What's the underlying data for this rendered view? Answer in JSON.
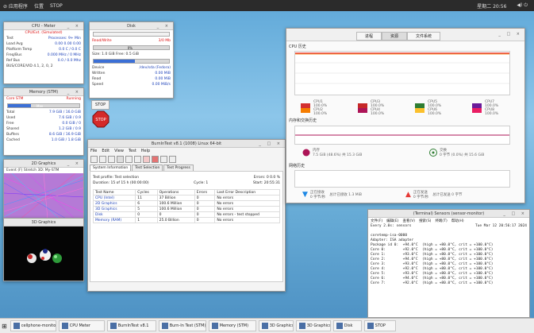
{
  "topbar": {
    "apps": "⊘ 应用程序",
    "places": "位置",
    "stop": "STOP",
    "clock": "星期二 20:56",
    "sys": "◀) ⏻"
  },
  "cpu_win": {
    "title": "CPU - Meter",
    "header": "CPU/Ext. (Simulated)",
    "rows": [
      {
        "k": "Test",
        "v": "Processes: 9+ Min"
      },
      {
        "k": "Load Avg",
        "v": "0.00 0.00 0.00"
      },
      {
        "k": "Platform Temp",
        "v": "0.0 C / 0.0 C"
      },
      {
        "k": "Freq/Bus",
        "v": "0.000 MHz / 0 MHz"
      },
      {
        "k": "Ref Bus",
        "v": "0.0 / 0.0 Mhz"
      }
    ],
    "footer": "BUS/CORE/VID 4.1, 2, 0, 2"
  },
  "mem_win": {
    "title": "Memory (STM)",
    "cpu_label": "Core STM",
    "cpu_value": "Running",
    "bar_label": "Max",
    "bar_pct": 0.32,
    "rows": [
      {
        "k": "Total",
        "v": "7.9 GiB / 16.0 GiB"
      },
      {
        "k": "Used",
        "v": "7.6 GiB / 0.9"
      },
      {
        "k": "Free",
        "v": "0.0 GiB / 0"
      },
      {
        "k": "Shared",
        "v": "1.2 GiB / 0.9"
      },
      {
        "k": "Buffers",
        "v": "8.6 GiB / 16.9 GiB"
      },
      {
        "k": "Cached",
        "v": "1.0 GiB / 1.8 GiB"
      }
    ]
  },
  "disk_win": {
    "title": "Disk",
    "read_label": "Read/Write",
    "read_value": "3/0 Mb",
    "bar1_label": "0%",
    "size_row": "Size: 1.0 GiB    Free: 0.5 GiB",
    "rows": [
      {
        "k": "Device",
        "v": "/dev/sda (Fedora)"
      },
      {
        "k": "Written",
        "v": "0.00 MiB"
      },
      {
        "k": "Read",
        "v": "0.00 MiB"
      },
      {
        "k": "Speed",
        "v": "0.00 MiB/s"
      }
    ],
    "stop_label": "STOP"
  },
  "graphics1": {
    "title": "3D Graphics",
    "fps": "Event (F) Stretch 3D: My-STM"
  },
  "graphics2": {
    "title": "3D Graphics"
  },
  "burn_win": {
    "title": "BurnInTest v8.1 (1008) Linux 64-bit",
    "menu": [
      "File",
      "Edit",
      "View",
      "Test",
      "Help"
    ],
    "tabs": [
      "System Information",
      "Test Selection",
      "Test Progress"
    ],
    "status_left": "Test profile: Test selection",
    "status_right": "Errors: 0     0.0 %",
    "duration": "Duration: 15  of  15  h (00:00:00)",
    "cycle": "Cycle: 1",
    "time_right": "Start: 20:55:31",
    "columns": [
      "Test Name",
      "Cycles",
      "Operations",
      "Errors",
      "Last Error Description"
    ],
    "rows": [
      [
        "CPU (Intel)",
        "11",
        "37 Billion",
        "0",
        "No errors"
      ],
      [
        "2D Graphics",
        "6",
        "100.6 Million",
        "0",
        "No errors"
      ],
      [
        "3D Graphics",
        "5",
        "100.6 Million",
        "0",
        "No errors"
      ],
      [
        "Disk",
        "0",
        "0",
        "0",
        "No errors - test stopped"
      ],
      [
        "Memory (RAM)",
        "1",
        "25.0 Billion",
        "0",
        "No errors"
      ]
    ]
  },
  "sysmon": {
    "tabs": [
      "进程",
      "资源",
      "文件系统"
    ],
    "cpu_title": "CPU 历史",
    "cpu_legend": [
      {
        "name": "CPU1 100.0%",
        "sub": "CPU2 100.0%",
        "c1": "#d32f2f",
        "c2": "#f57c00"
      },
      {
        "name": "CPU3 100.0%",
        "sub": "CPU4 100.0%",
        "c1": "#c62828",
        "c2": "#ad1457"
      },
      {
        "name": "CPU5 100.0%",
        "sub": "CPU6 100.0%",
        "c1": "#2e7d32",
        "c2": "#fbc02d"
      },
      {
        "name": "CPU7 100.0%",
        "sub": "CPU8 100.0%",
        "c1": "#6a1b9a",
        "c2": "#e91e63"
      }
    ],
    "mem_title": "内存和交换历史",
    "mem_label": "内存",
    "mem_value": "7.5 GiB (48.6%) 共 15.3 GiB",
    "swap_label": "交换",
    "swap_value": "0 字节 (0.0%) 共 15.6 GiB",
    "net_title": "网络历史",
    "recv_label": "正在接收",
    "recv_value": "0 字节/秒",
    "recv_total": "总计已接收 1.3 MiB",
    "send_label": "正在发送",
    "send_value": "0 字节/秒",
    "send_total": "总计已发送 0 字节"
  },
  "terminal": {
    "title": "(Terminal) Sensors (sensor-monitor)",
    "menu": [
      "文件(F)",
      "编辑(E)",
      "查看(V)",
      "搜索(S)",
      "终端(T)",
      "帮助(H)"
    ],
    "head_left": "Every 2.0s: sensors",
    "head_right": "Tue Mar 12 20:56:17 2024",
    "lines": [
      "coretemp-isa-0000",
      "Adapter: ISA adapter",
      "Package id 0:  +94.0°C  (high = +80.0°C, crit = +100.0°C)",
      "Core 0:        +92.0°C  (high = +80.0°C, crit = +100.0°C)",
      "Core 1:        +93.0°C  (high = +80.0°C, crit = +100.0°C)",
      "Core 2:        +94.0°C  (high = +80.0°C, crit = +100.0°C)",
      "Core 3:        +93.0°C  (high = +80.0°C, crit = +100.0°C)",
      "Core 4:        +92.0°C  (high = +80.0°C, crit = +100.0°C)",
      "Core 5:        +93.0°C  (high = +80.0°C, crit = +100.0°C)",
      "Core 6:        +94.0°C  (high = +80.0°C, crit = +100.0°C)",
      "Core 7:        +92.0°C  (high = +80.0°C, crit = +100.0°C)"
    ]
  },
  "taskbar": [
    "cellphone-monitor",
    "CPU Meter",
    "BurnInTest v8.1",
    "Burn-In Test (STM)",
    "Memory (STM)",
    "3D Graphics",
    "3D Graphics",
    "Disk",
    "STOP"
  ]
}
